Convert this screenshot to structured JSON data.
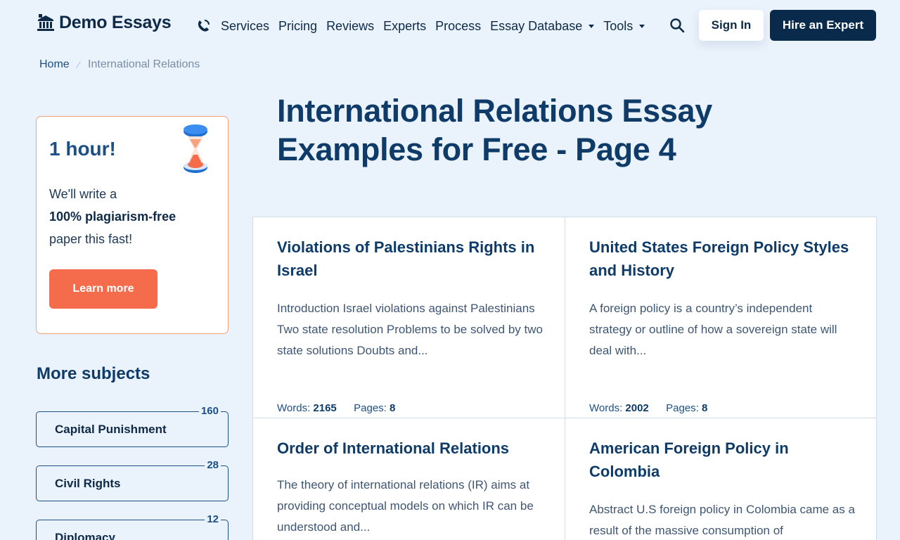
{
  "header": {
    "logo_text": "Demo Essays",
    "nav": [
      {
        "label": "Services"
      },
      {
        "label": "Pricing"
      },
      {
        "label": "Reviews"
      },
      {
        "label": "Experts"
      },
      {
        "label": "Process"
      },
      {
        "label": "Essay Database",
        "dropdown": true
      },
      {
        "label": "Tools",
        "dropdown": true
      }
    ],
    "sign_in_label": "Sign In",
    "hire_label": "Hire an Expert"
  },
  "breadcrumb": {
    "home": "Home",
    "current": "International Relations"
  },
  "promo": {
    "title": "1 hour!",
    "line1": "We'll write a",
    "line2": "100% plagiarism-free",
    "line3": "paper this fast!",
    "button_label": "Learn more"
  },
  "subjects": {
    "title": "More subjects",
    "items": [
      {
        "label": "Capital Punishment",
        "count": "160"
      },
      {
        "label": "Civil Rights",
        "count": "28"
      },
      {
        "label": "Diplomacy",
        "count": "12"
      }
    ]
  },
  "main": {
    "title": "International Relations Essay Examples for Free - Page 4",
    "words_label": "Words:",
    "pages_label": "Pages:",
    "essays": [
      {
        "title": "Violations of Palestinians Rights in Israel",
        "excerpt": "Introduction Israel violations against Palestinians Two state resolution Problems to be solved by two state solutions Doubts and...",
        "words": "2165",
        "pages": "8"
      },
      {
        "title": "United States Foreign Policy Styles and History",
        "excerpt": "A foreign policy is a country’s independent strategy or outline of how a sovereign state will deal with...",
        "words": "2002",
        "pages": "8"
      },
      {
        "title": "Order of International Relations",
        "excerpt": "The theory of international relations (IR) aims at providing conceptual models on which IR can be understood and...",
        "words": "",
        "pages": ""
      },
      {
        "title": "American Foreign Policy in Colombia",
        "excerpt": "Abstract U.S foreign policy in Colombia came as a result of the massive consumption of",
        "words": "",
        "pages": ""
      }
    ]
  },
  "colors": {
    "background": "#eaf2fb",
    "primary": "#0f3b68",
    "accent": "#f56c4c",
    "dark_button": "#0a2a4c"
  },
  "icons": [
    "bank-icon",
    "phone-icon",
    "search-icon",
    "hourglass-icon",
    "chevron-down-icon"
  ]
}
